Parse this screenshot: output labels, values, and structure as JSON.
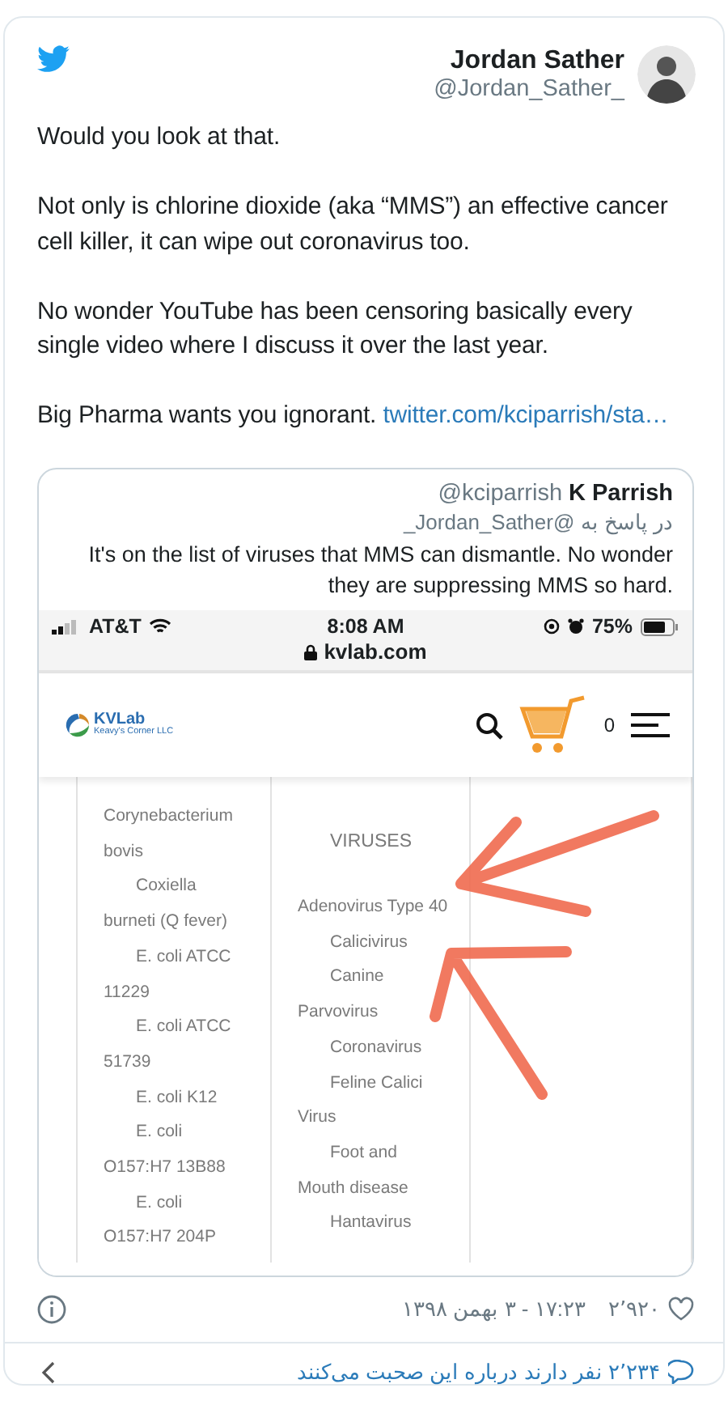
{
  "tweet": {
    "author": {
      "name": "Jordan Sather",
      "handle": "@Jordan_Sather_"
    },
    "paragraphs": [
      {
        "text": "Would you look at that."
      },
      {
        "text": "Not only is chlorine dioxide (aka “MMS”) an effective cancer cell killer, it can wipe out coronavirus too."
      },
      {
        "text": "No wonder YouTube has been censoring basically every single video where I discuss it over the last year."
      },
      {
        "text": "Big Pharma wants you ignorant.",
        "link": "twitter.com/kciparrish/sta…"
      }
    ]
  },
  "quoted_tweet": {
    "name": "K Parrish",
    "handle": "@kciparrish",
    "reply_to": "در پاسخ به @Jordan_Sather_",
    "text": "It's on the list of viruses that MMS can dismantle. No wonder they are suppressing MMS so hard.",
    "screenshot": {
      "status_bar": {
        "carrier": "AT&T",
        "time": "8:08 AM",
        "battery": "75%",
        "url": "kvlab.com"
      },
      "site": {
        "logo_title": "KVLab",
        "logo_subtitle": "Keavy's Corner LLC",
        "cart_count": "0"
      },
      "columns": [
        {
          "lines": [
            {
              "text": "Corynebacterium",
              "indented": false
            },
            {
              "text": "bovis",
              "indented": false
            },
            {
              "text": "Coxiella",
              "indented": true
            },
            {
              "text": "burneti (Q fever)",
              "indented": false
            },
            {
              "text": "E. coli ATCC",
              "indented": true
            },
            {
              "text": "11229",
              "indented": false
            },
            {
              "text": "E. coli ATCC",
              "indented": true
            },
            {
              "text": "51739",
              "indented": false
            },
            {
              "text": "E. coli K12",
              "indented": true
            },
            {
              "text": "E. coli",
              "indented": true
            },
            {
              "text": "O157:H7 13B88",
              "indented": false
            },
            {
              "text": "E. coli",
              "indented": true
            },
            {
              "text": "O157:H7 204P",
              "indented": false
            }
          ]
        },
        {
          "heading": "VIRUSES",
          "lines": [
            {
              "text": "Adenovirus Type 40",
              "indented": false
            },
            {
              "text": "Calicivirus",
              "indented": true
            },
            {
              "text": "Canine",
              "indented": true
            },
            {
              "text": "Parvovirus",
              "indented": false
            },
            {
              "text": "Coronavirus",
              "indented": true
            },
            {
              "text": "Feline Calici",
              "indented": true
            },
            {
              "text": "Virus",
              "indented": false
            },
            {
              "text": "Foot and",
              "indented": true
            },
            {
              "text": "Mouth disease",
              "indented": false
            },
            {
              "text": "Hantavirus",
              "indented": true
            }
          ]
        },
        {}
      ]
    }
  },
  "footer": {
    "likes": "۲٬۹۲۰",
    "timestamp": "۱۷:۲۳ - ۳ بهمن ۱۳۹۸",
    "conversation": "۲٬۲۳۴ نفر دارند درباره این صحبت می‌کنند"
  }
}
